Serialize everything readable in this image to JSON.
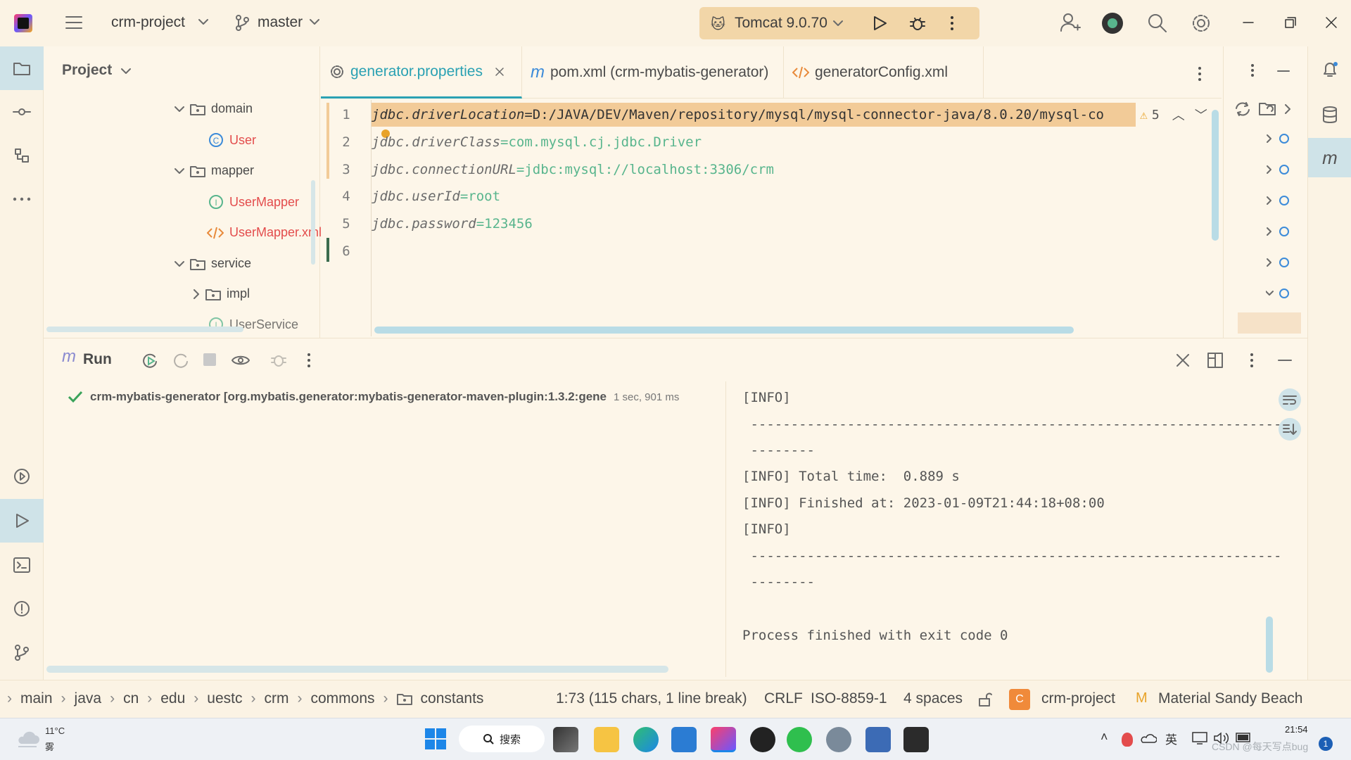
{
  "titlebar": {
    "project_name": "crm-project",
    "branch": "master",
    "run_config": "Tomcat 9.0.70"
  },
  "project_panel": {
    "title": "Project",
    "tree": [
      {
        "label": "domain",
        "type": "folder",
        "expanded": true
      },
      {
        "label": "User",
        "type": "class"
      },
      {
        "label": "mapper",
        "type": "folder",
        "expanded": true
      },
      {
        "label": "UserMapper",
        "type": "interface"
      },
      {
        "label": "UserMapper.xml",
        "type": "xml"
      },
      {
        "label": "service",
        "type": "folder",
        "expanded": true
      },
      {
        "label": "impl",
        "type": "folder",
        "expanded": false
      },
      {
        "label": "UserService",
        "type": "interface"
      }
    ]
  },
  "editor": {
    "tabs": [
      {
        "label": "generator.properties",
        "active": true,
        "closable": true
      },
      {
        "label": "pom.xml (crm-mybatis-generator)",
        "active": false
      },
      {
        "label": "generatorConfig.xml",
        "active": false
      }
    ],
    "warnings": "5",
    "line_numbers": [
      "1",
      "2",
      "3",
      "4",
      "5",
      "6"
    ],
    "lines": [
      {
        "key": "jdbc.driverLocation",
        "value": "D:/JAVA/DEV/Maven/repository/mysql/mysql-connector-java/8.0.20/mysql-co"
      },
      {
        "key": "jdbc.driverClass",
        "value": "com.mysql.cj.jdbc.Driver"
      },
      {
        "key": "jdbc.connectionURL",
        "value": "jdbc:mysql://localhost:3306/crm"
      },
      {
        "key": "jdbc.userId",
        "value": "root"
      },
      {
        "key": "jdbc.password",
        "value": "123456"
      },
      {
        "key": "",
        "value": ""
      }
    ]
  },
  "run_panel": {
    "title": "Run",
    "task_label": "crm-mybatis-generator [org.mybatis.generator:mybatis-generator-maven-plugin:1.3.2:gene",
    "task_time": "1 sec, 901 ms",
    "console": [
      "[INFO]",
      " ------------------------------------------------------------------",
      " --------",
      "[INFO] Total time:  0.889 s",
      "[INFO] Finished at: 2023-01-09T21:44:18+08:00",
      "[INFO]",
      " ------------------------------------------------------------------",
      " --------",
      "",
      "Process finished with exit code 0"
    ]
  },
  "statusbar": {
    "breadcrumbs": [
      "main",
      "java",
      "cn",
      "edu",
      "uestc",
      "crm",
      "commons",
      "constants"
    ],
    "position": "1:73 (115 chars, 1 line break)",
    "line_separator": "CRLF",
    "encoding": "ISO-8859-1",
    "indent": "4 spaces",
    "project": "crm-project",
    "theme": "Material Sandy Beach"
  },
  "taskbar": {
    "weather_temp": "11°C",
    "weather_desc": "雾",
    "search_label": "搜索",
    "ime": "英",
    "time": "21:54",
    "watermark": "CSDN @每天写点bug",
    "notification_count": "1"
  }
}
